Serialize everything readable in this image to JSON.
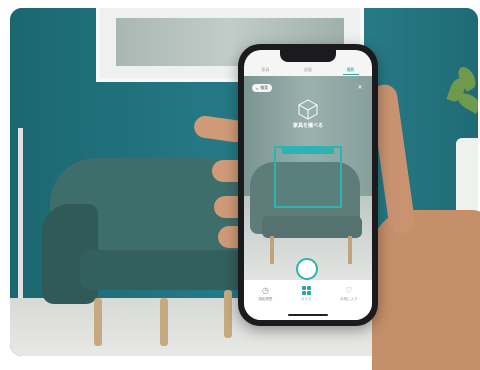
{
  "app": {
    "tabs": [
      {
        "label": "家具",
        "active": false
      },
      {
        "label": "部屋",
        "active": false
      },
      {
        "label": "撮影",
        "active": true
      }
    ],
    "search_chip": "検索",
    "close_glyph": "✕",
    "caption": "家具を撮べる",
    "nav": [
      {
        "label": "撮影履歴",
        "icon": "history-icon",
        "active": false
      },
      {
        "label": "カメラ",
        "icon": "grid-icon",
        "active": true
      },
      {
        "label": "お気に入り",
        "icon": "heart-icon",
        "active": false
      }
    ]
  },
  "colors": {
    "accent": "#2fb2b2",
    "wall": "#247784",
    "armchair": "#3d6e6c"
  }
}
